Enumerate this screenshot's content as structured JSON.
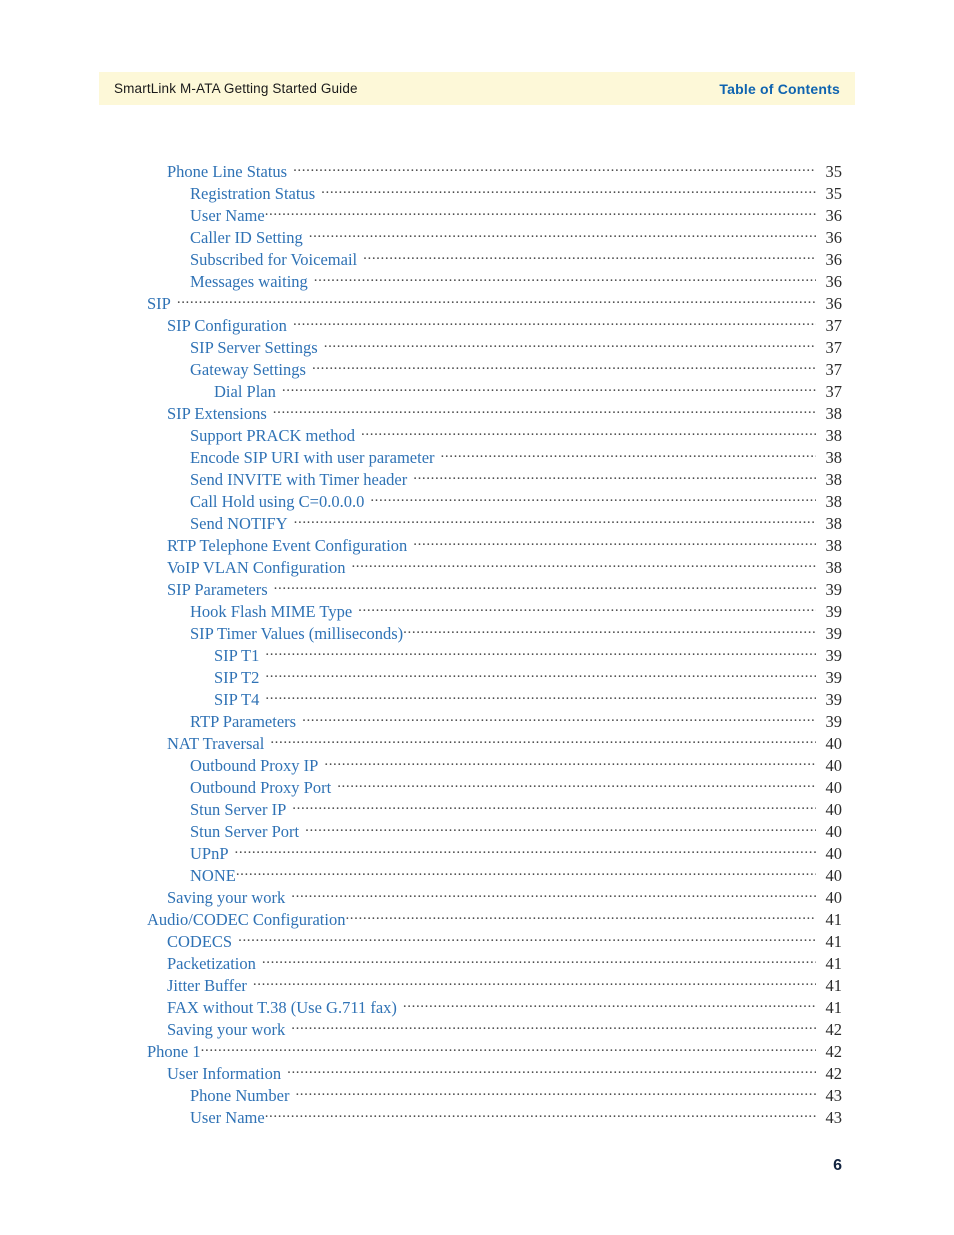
{
  "header": {
    "doc_title": "SmartLink M-ATA Getting Started Guide",
    "section_title": "Table of Contents",
    "band_color": "#fdf8d8",
    "section_title_color": "#0e63b0"
  },
  "footer": {
    "page_number": "6"
  },
  "toc": {
    "link_color": "#2f72b5",
    "pageno_color": "#2b2b2b",
    "entries": [
      {
        "label": "Phone Line Status",
        "page": "35",
        "level": 2,
        "gap": true
      },
      {
        "label": "Registration Status",
        "page": "35",
        "level": 3,
        "gap": true
      },
      {
        "label": "User Name",
        "page": "36",
        "level": 3,
        "gap": false
      },
      {
        "label": "Caller ID Setting",
        "page": "36",
        "level": 3,
        "gap": true
      },
      {
        "label": "Subscribed for Voicemail",
        "page": "36",
        "level": 3,
        "gap": true
      },
      {
        "label": "Messages waiting",
        "page": "36",
        "level": 3,
        "gap": true
      },
      {
        "label": "SIP",
        "page": "36",
        "level": 1,
        "gap": true
      },
      {
        "label": "SIP Configuration",
        "page": "37",
        "level": 2,
        "gap": true
      },
      {
        "label": "SIP Server Settings",
        "page": "37",
        "level": 3,
        "gap": true
      },
      {
        "label": "Gateway Settings",
        "page": "37",
        "level": 3,
        "gap": true
      },
      {
        "label": "Dial Plan",
        "page": "37",
        "level": 4,
        "gap": true
      },
      {
        "label": "SIP Extensions",
        "page": "38",
        "level": 2,
        "gap": true
      },
      {
        "label": "Support PRACK method",
        "page": "38",
        "level": 3,
        "gap": true
      },
      {
        "label": "Encode SIP URI with user parameter",
        "page": "38",
        "level": 3,
        "gap": true
      },
      {
        "label": "Send INVITE with Timer header",
        "page": "38",
        "level": 3,
        "gap": true
      },
      {
        "label": "Call Hold using C=0.0.0.0",
        "page": "38",
        "level": 3,
        "gap": true
      },
      {
        "label": "Send NOTIFY",
        "page": "38",
        "level": 3,
        "gap": true
      },
      {
        "label": "RTP Telephone Event Configuration",
        "page": "38",
        "level": 2,
        "gap": true
      },
      {
        "label": "VoIP VLAN Configuration",
        "page": "38",
        "level": 2,
        "gap": true
      },
      {
        "label": "SIP Parameters",
        "page": "39",
        "level": 2,
        "gap": true
      },
      {
        "label": "Hook Flash MIME Type",
        "page": "39",
        "level": 3,
        "gap": true
      },
      {
        "label": "SIP Timer Values (milliseconds)",
        "page": "39",
        "level": 3,
        "gap": false
      },
      {
        "label": "SIP T1",
        "page": "39",
        "level": 4,
        "gap": true
      },
      {
        "label": "SIP T2",
        "page": "39",
        "level": 4,
        "gap": true
      },
      {
        "label": "SIP T4",
        "page": "39",
        "level": 4,
        "gap": true
      },
      {
        "label": "RTP Parameters",
        "page": "39",
        "level": 3,
        "gap": true
      },
      {
        "label": "NAT Traversal",
        "page": "40",
        "level": 2,
        "gap": true
      },
      {
        "label": "Outbound Proxy IP",
        "page": "40",
        "level": 3,
        "gap": true
      },
      {
        "label": "Outbound Proxy Port",
        "page": "40",
        "level": 3,
        "gap": true
      },
      {
        "label": "Stun Server IP",
        "page": "40",
        "level": 3,
        "gap": true
      },
      {
        "label": "Stun Server Port",
        "page": "40",
        "level": 3,
        "gap": true
      },
      {
        "label": "UPnP",
        "page": "40",
        "level": 3,
        "gap": true
      },
      {
        "label": "NONE",
        "page": "40",
        "level": 3,
        "gap": false
      },
      {
        "label": "Saving your work",
        "page": "40",
        "level": 2,
        "gap": true
      },
      {
        "label": "Audio/CODEC Configuration",
        "page": "41",
        "level": 1,
        "gap": false
      },
      {
        "label": "CODECS",
        "page": "41",
        "level": 2,
        "gap": true
      },
      {
        "label": "Packetization",
        "page": "41",
        "level": 2,
        "gap": true
      },
      {
        "label": "Jitter Buffer",
        "page": "41",
        "level": 2,
        "gap": true
      },
      {
        "label": "FAX without T.38 (Use G.711 fax)",
        "page": "41",
        "level": 2,
        "gap": true
      },
      {
        "label": "Saving your work",
        "page": "42",
        "level": 2,
        "gap": true
      },
      {
        "label": "Phone 1",
        "page": "42",
        "level": 1,
        "gap": false
      },
      {
        "label": "User Information",
        "page": "42",
        "level": 2,
        "gap": true
      },
      {
        "label": "Phone Number",
        "page": "43",
        "level": 3,
        "gap": true
      },
      {
        "label": "User Name",
        "page": "43",
        "level": 3,
        "gap": false
      }
    ]
  }
}
